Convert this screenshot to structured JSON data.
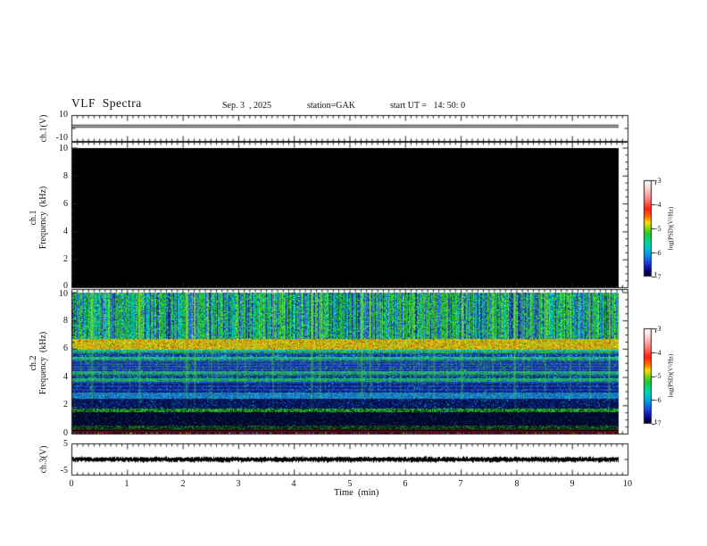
{
  "header": {
    "title": "VLF  Spectra",
    "date": "Sep. 3  , 2025",
    "station": "station=GAK",
    "start_ut": "start UT =   14: 50: 0"
  },
  "axes": {
    "x_ticks": [
      "0",
      "1",
      "2",
      "3",
      "4",
      "5",
      "6",
      "7",
      "8",
      "9",
      "10"
    ],
    "x_label": "Time  (min)",
    "p1_yticks": [
      "10",
      "-10"
    ],
    "p1_label": "ch.1(V)",
    "p2_yticks": [
      "10",
      "8",
      "6",
      "4",
      "2",
      "0"
    ],
    "p2_label1": "ch.1",
    "p2_label2": "Frequency  (kHz)",
    "p3_yticks": [
      "10",
      "8",
      "6",
      "4",
      "2",
      "0"
    ],
    "p3_label1": "ch.2",
    "p3_label2": "Frequency  (kHz)",
    "p4_yticks": [
      "5",
      "-5"
    ],
    "p4_label": "ch.3(V)"
  },
  "colorbar": {
    "ticks": [
      "-3",
      "-4",
      "-5",
      "-6",
      "-7"
    ],
    "label": "log(PSD)(V²/Hz)",
    "zrange": [
      -7,
      -3
    ],
    "stops": [
      [
        0,
        "#ffffff"
      ],
      [
        0.08,
        "#ffd8d8"
      ],
      [
        0.2,
        "#ff8080"
      ],
      [
        0.3,
        "#ff2010"
      ],
      [
        0.38,
        "#ff7000"
      ],
      [
        0.44,
        "#ffe000"
      ],
      [
        0.5,
        "#80d810"
      ],
      [
        0.56,
        "#20c830"
      ],
      [
        0.64,
        "#00d890"
      ],
      [
        0.7,
        "#00c8d0"
      ],
      [
        0.78,
        "#0090e0"
      ],
      [
        0.84,
        "#2050e8"
      ],
      [
        0.9,
        "#1018b0"
      ],
      [
        0.96,
        "#000060"
      ],
      [
        1.0,
        "#000005"
      ]
    ]
  },
  "chart_data": [
    {
      "id": "ch1_waveform",
      "type": "line",
      "panel_label": "ch.1(V)",
      "ylim": [
        -10,
        10
      ],
      "ytick_labels": [
        "10",
        "-10"
      ],
      "xlim": [
        0,
        10
      ],
      "data_end_min": 9.82,
      "signal": "flat quiet trace at 0 V for the whole record",
      "value_v": 0
    },
    {
      "id": "ch1_spectrogram",
      "type": "heatmap",
      "panel_label": "ch.1 Frequency (kHz)",
      "ylim": [
        0,
        10
      ],
      "ytick_labels": [
        "10",
        "8",
        "6",
        "4",
        "2",
        "0"
      ],
      "xlim": [
        0,
        10
      ],
      "data_end_min": 9.82,
      "zlabel": "log(PSD)(V²/Hz)",
      "zrange": [
        -7,
        -3
      ],
      "content": "uniform solid black: PSD at or below -7 everywhere (no signal)"
    },
    {
      "id": "ch2_spectrogram",
      "type": "heatmap",
      "panel_label": "ch.2 Frequency (kHz)",
      "ylim": [
        0,
        10
      ],
      "ytick_labels": [
        "10",
        "8",
        "6",
        "4",
        "2",
        "0"
      ],
      "xlim": [
        0,
        10
      ],
      "data_end_min": 9.82,
      "zlabel": "log(PSD)(V²/Hz)",
      "zrange": [
        -7,
        -3
      ],
      "seed": 20250903,
      "bands": [
        {
          "f0": 6.7,
          "f1": 10.01,
          "kind": "vstreak",
          "colors": [
            "#22b830",
            "#5ae446",
            "#00c6b4",
            "#2e5ce2",
            "#122c8c"
          ]
        },
        {
          "f0": 6.0,
          "f1": 6.7,
          "kind": "yellow",
          "colors": [
            "#d4cc10",
            "#a8b818",
            "#e89018",
            "#88b820",
            "#d83010"
          ]
        },
        {
          "f0": 5.15,
          "f1": 6.0,
          "kind": "rowmix",
          "colors": [
            "#18b8c8",
            "#28b838",
            "#2050c8",
            "#083068"
          ]
        },
        {
          "f0": 4.45,
          "f1": 5.15,
          "kind": "bluestripe",
          "colors": [
            "#2048c8",
            "#102878",
            "#28a838"
          ]
        },
        {
          "f0": 3.7,
          "f1": 4.45,
          "kind": "rowmix",
          "colors": [
            "#18a8a8",
            "#28b040",
            "#2060b0",
            "#0a3060"
          ]
        },
        {
          "f0": 2.95,
          "f1": 3.7,
          "kind": "darkblue",
          "colors": [
            "#1838b8",
            "#0a1f70",
            "#18a0c0"
          ]
        },
        {
          "f0": 2.5,
          "f1": 2.95,
          "kind": "cyan",
          "colors": [
            "#1890c8",
            "#1850b0"
          ]
        },
        {
          "f0": 1.85,
          "f1": 2.5,
          "kind": "navy",
          "colors": [
            "#041048",
            "#1030a0",
            "#0890b0"
          ]
        },
        {
          "f0": 1.55,
          "f1": 1.85,
          "kind": "greenline",
          "colors": [
            "#28a830",
            "#08280f"
          ]
        },
        {
          "f0": 0.6,
          "f1": 1.55,
          "kind": "deepnavy",
          "colors": [
            "#020828",
            "#102070"
          ]
        },
        {
          "f0": 0.4,
          "f1": 0.6,
          "kind": "dgreen",
          "colors": [
            "#187020",
            "#04101c"
          ]
        },
        {
          "f0": 0.12,
          "f1": 0.4,
          "kind": "maroon",
          "colors": [
            "#700010",
            "#100408"
          ],
          "line_f": [
            0.33,
            0.19
          ]
        },
        {
          "f0": 0.0,
          "f1": 0.12,
          "kind": "rgbnoise",
          "colors": [
            "#0a0a0e",
            "#d020d0",
            "#20c0c0",
            "#c0c020",
            "#2020c0",
            "#c02020"
          ]
        }
      ],
      "streaks_strong": [
        [
          0.35,
          0.9
        ],
        [
          0.55,
          0.6
        ],
        [
          1.2,
          1.0
        ],
        [
          2.05,
          1.0
        ],
        [
          2.2,
          0.9
        ],
        [
          2.5,
          0.7
        ],
        [
          3.1,
          0.7
        ],
        [
          3.6,
          0.8
        ],
        [
          4.3,
          1.0
        ],
        [
          4.45,
          0.8
        ],
        [
          5.2,
          0.9
        ],
        [
          5.35,
          0.8
        ],
        [
          5.9,
          0.6
        ],
        [
          6.5,
          0.7
        ],
        [
          7.0,
          0.8
        ],
        [
          7.55,
          0.7
        ],
        [
          7.95,
          1.0
        ],
        [
          8.5,
          0.7
        ],
        [
          8.95,
          0.6
        ],
        [
          9.3,
          0.8
        ],
        [
          9.65,
          0.9
        ]
      ],
      "streak_bright": "#a0e428",
      "streak_hot": "#ff7000"
    },
    {
      "id": "ch3_waveform",
      "type": "line",
      "panel_label": "ch.3(V)",
      "ylim": [
        -5,
        5
      ],
      "ytick_labels": [
        "5",
        "-5"
      ],
      "xlim": [
        0,
        10
      ],
      "data_end_min": 9.82,
      "signal": "dense black noise band centered on 0 V",
      "value_v": 0,
      "seed": 77
    }
  ]
}
